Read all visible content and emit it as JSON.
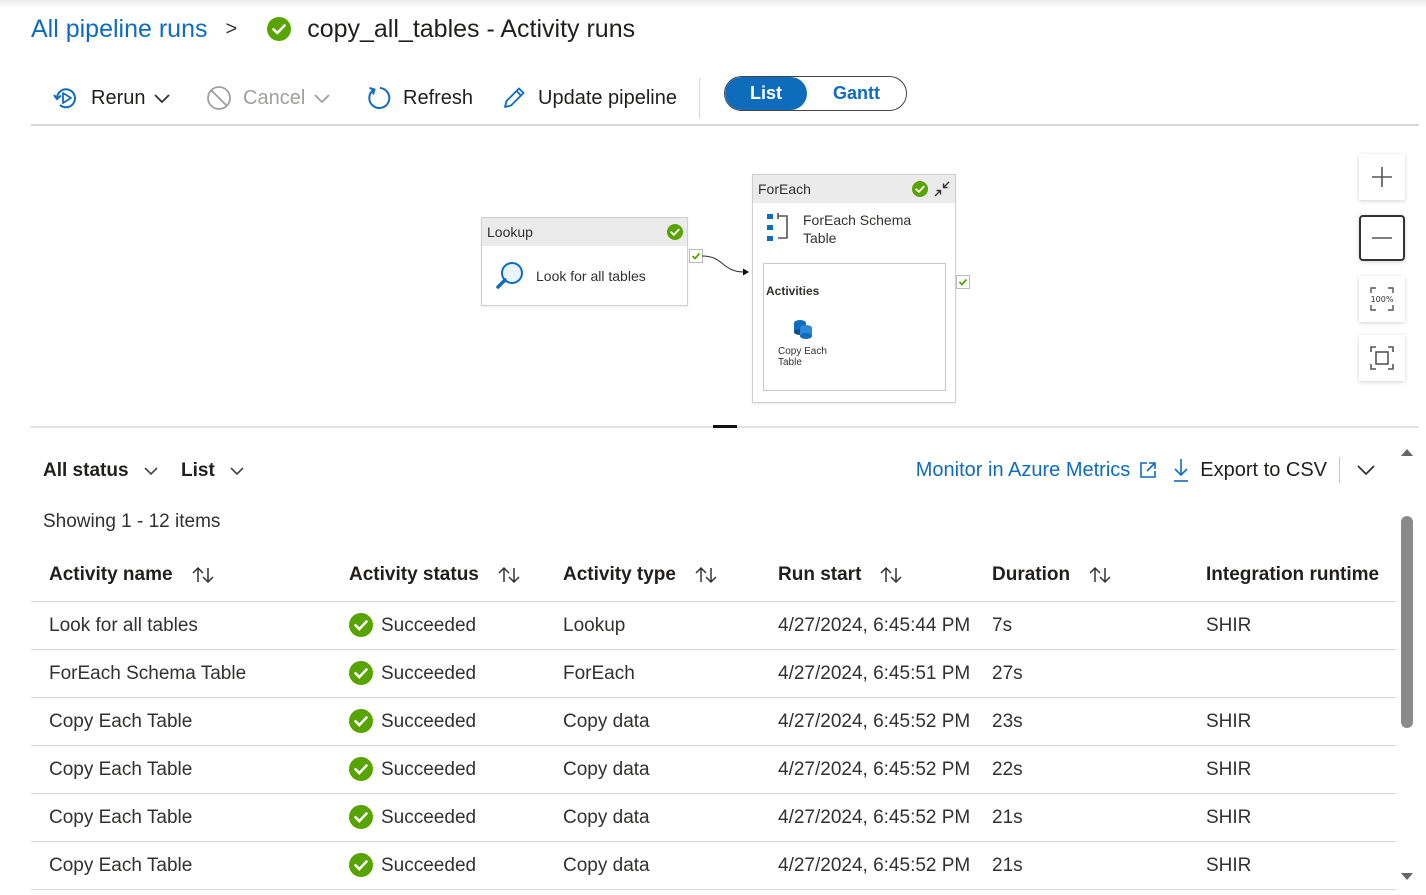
{
  "breadcrumb": {
    "parent_label": "All pipeline runs",
    "separator": ">",
    "title": "copy_all_tables - Activity runs"
  },
  "toolbar": {
    "rerun_label": "Rerun",
    "cancel_label": "Cancel",
    "refresh_label": "Refresh",
    "update_label": "Update pipeline",
    "view_toggle": {
      "options": [
        "List",
        "Gantt"
      ],
      "selected": "List"
    }
  },
  "canvas": {
    "lookup_node": {
      "header": "Lookup",
      "activity_name": "Look for all tables",
      "icon": "search-icon"
    },
    "foreach_node": {
      "header": "ForEach",
      "activity_name": "ForEach Schema Table",
      "activity_name_line1": "ForEach Schema",
      "activity_name_line2": "Table",
      "inner_title": "Activities",
      "inner_activity_line1": "Copy Each",
      "inner_activity_line2": "Table",
      "icon": "foreach-icon"
    },
    "zoom_controls": [
      "zoom-in",
      "zoom-out",
      "zoom-100",
      "fit-to-screen"
    ],
    "zoom_100_label": "100%"
  },
  "filters": {
    "status_label": "All status",
    "view_label": "List",
    "monitor_label": "Monitor in Azure Metrics",
    "export_label": "Export to CSV"
  },
  "showing_text": "Showing 1 - 12 items",
  "table": {
    "columns": [
      "Activity name",
      "Activity status",
      "Activity type",
      "Run start",
      "Duration",
      "Integration runtime"
    ],
    "rows": [
      {
        "name": "Look for all tables",
        "status": "Succeeded",
        "type": "Lookup",
        "run_start": "4/27/2024, 6:45:44 PM",
        "duration": "7s",
        "runtime": "SHIR"
      },
      {
        "name": "ForEach Schema Table",
        "status": "Succeeded",
        "type": "ForEach",
        "run_start": "4/27/2024, 6:45:51 PM",
        "duration": "27s",
        "runtime": ""
      },
      {
        "name": "Copy Each Table",
        "status": "Succeeded",
        "type": "Copy data",
        "run_start": "4/27/2024, 6:45:52 PM",
        "duration": "23s",
        "runtime": "SHIR"
      },
      {
        "name": "Copy Each Table",
        "status": "Succeeded",
        "type": "Copy data",
        "run_start": "4/27/2024, 6:45:52 PM",
        "duration": "22s",
        "runtime": "SHIR"
      },
      {
        "name": "Copy Each Table",
        "status": "Succeeded",
        "type": "Copy data",
        "run_start": "4/27/2024, 6:45:52 PM",
        "duration": "21s",
        "runtime": "SHIR"
      },
      {
        "name": "Copy Each Table",
        "status": "Succeeded",
        "type": "Copy data",
        "run_start": "4/27/2024, 6:45:52 PM",
        "duration": "21s",
        "runtime": "SHIR"
      }
    ]
  },
  "colors": {
    "accent": "#0f6cbd",
    "success": "#57a300",
    "text": "#201f1e",
    "disabled": "#a19f9d"
  }
}
